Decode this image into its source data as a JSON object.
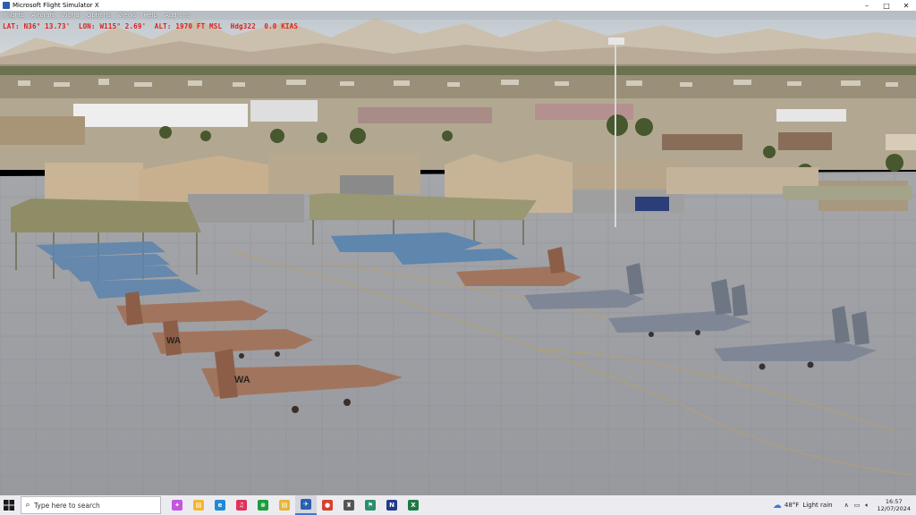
{
  "window": {
    "title": "Microsoft Flight Simulator X",
    "controls": {
      "minimize": "–",
      "maximize": "□",
      "close": "✕"
    }
  },
  "menu": [
    "Flights",
    "Aircraft",
    "World",
    "Options",
    "Views",
    "Help",
    "Add-ons"
  ],
  "hud": {
    "text": "LAT: N36° 13.73'  LON: W115° 2.69'  ALT: 1970 FT MSL  Hdg322  0.0 KIAS"
  },
  "scene": {
    "aircraft_tail_code": "WA",
    "colors": {
      "sky": "#cfd6dc",
      "apron": "#9ea0a6",
      "hud": "#e0201a"
    }
  },
  "taskbar": {
    "search_placeholder": "Type here to search",
    "apps": [
      {
        "name": "copilot",
        "glyph": "✦",
        "color": "#c455e0"
      },
      {
        "name": "file-explorer",
        "glyph": "▤",
        "color": "#f2b632"
      },
      {
        "name": "edge",
        "glyph": "e",
        "color": "#1f8ad6"
      },
      {
        "name": "music",
        "glyph": "♫",
        "color": "#e0325a"
      },
      {
        "name": "xbox",
        "glyph": "⊗",
        "color": "#1a9d3a"
      },
      {
        "name": "folder",
        "glyph": "▤",
        "color": "#e9b43a"
      },
      {
        "name": "flight-sim",
        "glyph": "✈",
        "color": "#2a5fae"
      },
      {
        "name": "chrome",
        "glyph": "●",
        "color": "#d8402f"
      },
      {
        "name": "app-castle",
        "glyph": "♜",
        "color": "#555"
      },
      {
        "name": "app-green",
        "glyph": "⚑",
        "color": "#2a8f6a"
      },
      {
        "name": "onenote",
        "glyph": "N",
        "color": "#233a8c"
      },
      {
        "name": "excel",
        "glyph": "X",
        "color": "#1d7a45"
      }
    ],
    "active_app": "flight-sim",
    "weather": {
      "temp": "48°F",
      "condition": "Light rain"
    },
    "time": "16:57",
    "date": "12/07/2024"
  }
}
